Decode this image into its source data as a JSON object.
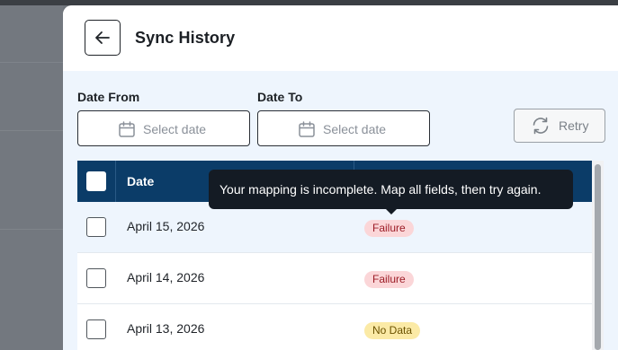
{
  "header": {
    "title": "Sync History",
    "back_icon": "arrow-left-icon"
  },
  "filters": {
    "date_from": {
      "label": "Date From",
      "placeholder": "Select date",
      "icon": "calendar-icon"
    },
    "date_to": {
      "label": "Date To",
      "placeholder": "Select date",
      "icon": "calendar-icon"
    },
    "retry": {
      "label": "Retry",
      "icon": "refresh-icon"
    }
  },
  "table": {
    "columns": [
      "Date",
      ""
    ],
    "rows": [
      {
        "date": "April 15, 2026",
        "status": "Failure",
        "status_type": "failure"
      },
      {
        "date": "April 14, 2026",
        "status": "Failure",
        "status_type": "failure"
      },
      {
        "date": "April 13, 2026",
        "status": "No Data",
        "status_type": "nodata"
      }
    ]
  },
  "tooltip": {
    "text": "Your mapping is incomplete. Map all fields, then try again."
  },
  "colors": {
    "header_bg": "#0b3c68",
    "content_bg": "#eef5fd",
    "failure_bg": "#fbd6d8",
    "nodata_bg": "#fbeaa6",
    "tooltip_bg": "#141b24"
  }
}
